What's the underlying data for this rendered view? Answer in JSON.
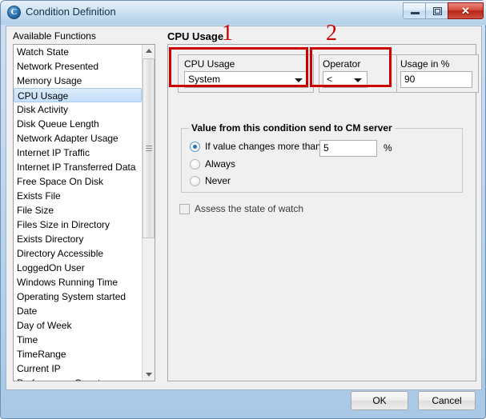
{
  "window": {
    "title": "Condition Definition",
    "icon": "app-circle-c-icon",
    "icon_letter": "C",
    "controls": {
      "minimize": "minimize-icon",
      "maximize": "maximize-icon",
      "close": "close-icon",
      "close_glyph": "✕"
    }
  },
  "left_pane": {
    "label": "Available Functions",
    "selected_index": 3,
    "items": [
      "Watch State",
      "Network Presented",
      "Memory Usage",
      "CPU Usage",
      "Disk Activity",
      "Disk Queue Length",
      "Network Adapter Usage",
      "Internet IP Traffic",
      "Internet IP Transferred Data",
      "Free Space On Disk",
      "Exists File",
      "File Size",
      "Files Size in Directory",
      "Exists Directory",
      "Directory Accessible",
      "LoggedOn User",
      "Windows Running Time",
      "Operating System started",
      "Date",
      "Day of Week",
      "Time",
      "TimeRange",
      "Current IP",
      "Performance Counter"
    ]
  },
  "right_pane": {
    "heading": "CPU Usage",
    "source_group": {
      "label": "CPU Usage",
      "value": "System",
      "arrow": "chevron-down-icon"
    },
    "operator_group": {
      "operator_label": "Operator",
      "operator_value": "<",
      "usage_label": "Usage in %",
      "usage_value": "90",
      "arrow": "chevron-down-icon"
    },
    "send_group": {
      "title": "Value from this condition send to CM server",
      "options": [
        {
          "label": "If value changes more than",
          "selected": true
        },
        {
          "label": "Always",
          "selected": false
        },
        {
          "label": "Never",
          "selected": false
        }
      ],
      "threshold_value": "5",
      "percent_sign": "%"
    },
    "assess_checkbox": {
      "label": "Assess the state of watch",
      "checked": false
    }
  },
  "annotations": [
    {
      "number": "1"
    },
    {
      "number": "2"
    }
  ],
  "buttons": {
    "ok": "OK",
    "cancel": "Cancel"
  },
  "colors": {
    "annotation_red": "#cc0000",
    "selection_blue": "#cfe4fa",
    "close_red": "#b62417"
  }
}
